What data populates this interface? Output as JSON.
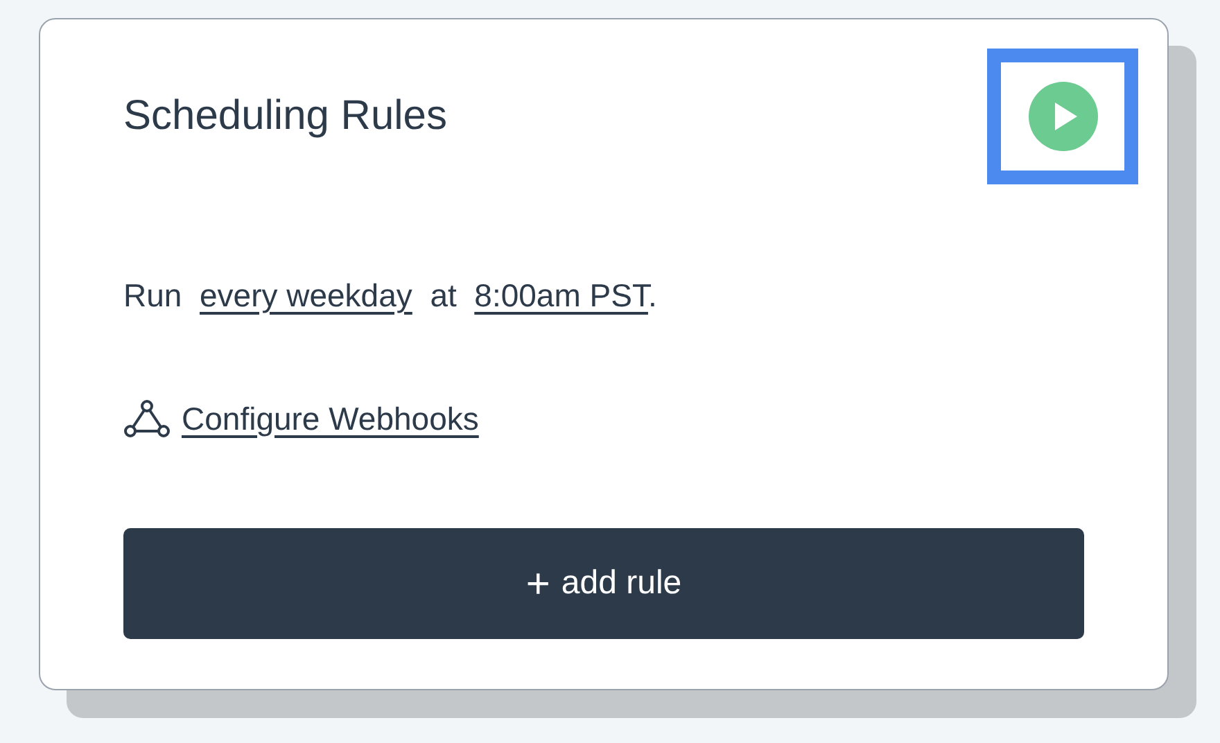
{
  "card": {
    "title": "Scheduling Rules",
    "play_button": {
      "focused": true
    },
    "schedule": [
      {
        "kind": "text",
        "text": "Run"
      },
      {
        "kind": "link",
        "text": "every weekday"
      },
      {
        "kind": "text",
        "text": "at"
      },
      {
        "kind": "link",
        "text": "8:00am PST"
      },
      {
        "kind": "text",
        "text": "."
      }
    ],
    "webhooks_link": "Configure Webhooks",
    "add_button": {
      "icon": "+",
      "label": "add rule"
    }
  }
}
